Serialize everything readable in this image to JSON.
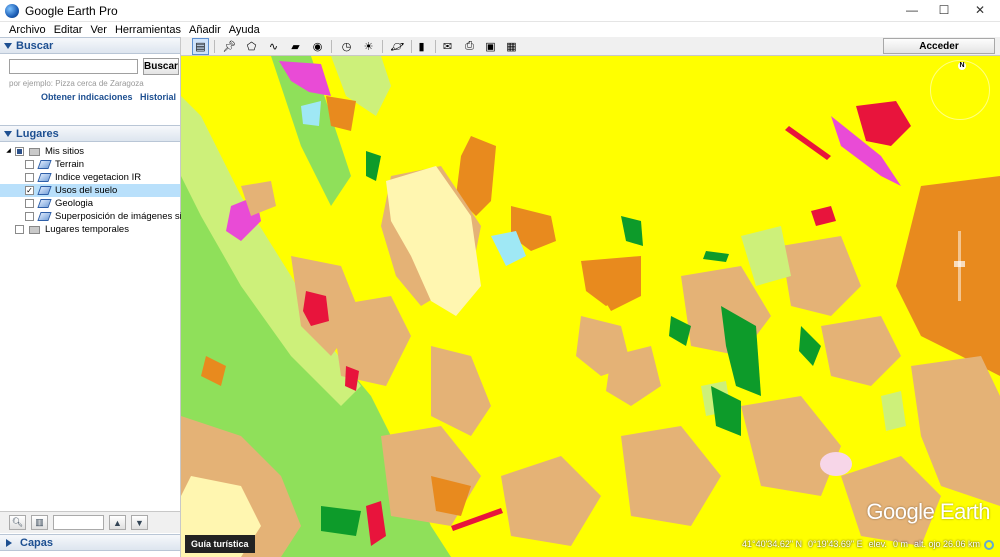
{
  "window": {
    "title": "Google Earth Pro",
    "controls": {
      "minimize": "—",
      "maximize": "☐",
      "close": "✕"
    }
  },
  "menu": [
    "Archivo",
    "Editar",
    "Ver",
    "Herramientas",
    "Añadir",
    "Ayuda"
  ],
  "search": {
    "header": "Buscar",
    "input_value": "",
    "button_label": "Buscar",
    "hint": "por ejemplo: Pizza cerca de Zaragoza",
    "link_directions": "Obtener indicaciones",
    "link_history": "Historial"
  },
  "places": {
    "header": "Lugares",
    "items": [
      {
        "label": "Mis sitios",
        "checked": "partial",
        "icon": "folder-icon"
      },
      {
        "label": "Terrain",
        "checked": false,
        "icon": "layer-icon"
      },
      {
        "label": "Indice vegetacion IR",
        "checked": false,
        "icon": "layer-icon"
      },
      {
        "label": "Usos del suelo",
        "checked": true,
        "icon": "layer-icon"
      },
      {
        "label": "Geologia",
        "checked": false,
        "icon": "layer-icon"
      },
      {
        "label": "Superposición de imágenes si...",
        "checked": false,
        "icon": "layer-icon"
      },
      {
        "label": "Lugares temporales",
        "checked": false,
        "icon": "folder-icon"
      }
    ]
  },
  "layers": {
    "header": "Capas"
  },
  "toolbar": {
    "login_label": "Acceder",
    "icons": [
      "sidebar-toggle-icon",
      "add-placemark-icon",
      "add-polygon-icon",
      "add-path-icon",
      "add-image-overlay-icon",
      "record-tour-icon",
      "historical-imagery-icon",
      "sunlight-icon",
      "switch-planet-icon",
      "ruler-icon",
      "email-icon",
      "print-icon",
      "save-image-icon",
      "view-in-maps-icon"
    ]
  },
  "map": {
    "watermark": "Google Earth",
    "compass_north": "N",
    "tour_tab": "Guía turística",
    "status": {
      "lat": "41°40'34.62\" N",
      "lon": "0°19'43.69\" E",
      "elev_label": "elev.",
      "elev_value": "0 m",
      "eye_alt": "alt. ojo 26.06 km"
    },
    "colors": {
      "base": "#ffff00",
      "orange": "#e88a1e",
      "tan": "#e4b276",
      "lightgreen": "#8fe05a",
      "palegreen": "#cdf07a",
      "cream": "#fff6b0",
      "red": "#e8143c",
      "magenta": "#e94bd6",
      "darkgreen": "#0d9b2a",
      "cyan": "#9fe8f5"
    }
  }
}
